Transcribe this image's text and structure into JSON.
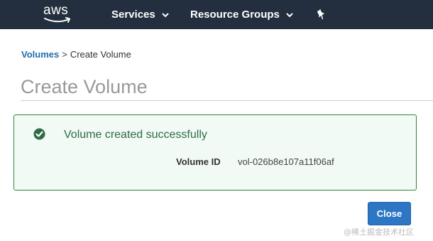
{
  "header": {
    "logo_text": "aws",
    "nav": [
      {
        "label": "Services"
      },
      {
        "label": "Resource Groups"
      }
    ],
    "pin_icon": "pin-icon"
  },
  "breadcrumb": {
    "parent": "Volumes",
    "separator": ">",
    "current": "Create Volume"
  },
  "page": {
    "title": "Create Volume"
  },
  "alert": {
    "icon": "check-circle-icon",
    "title": "Volume created successfully",
    "details": {
      "label": "Volume ID",
      "value": "vol-026b8e107a11f06af"
    }
  },
  "actions": {
    "close_label": "Close"
  },
  "watermark": "@稀土掘金技术社区",
  "colors": {
    "header_bg": "#232f3e",
    "link": "#1f6ead",
    "success_border": "#2e8540",
    "success_bg": "#f1faf4",
    "primary_button": "#2d76c4"
  }
}
